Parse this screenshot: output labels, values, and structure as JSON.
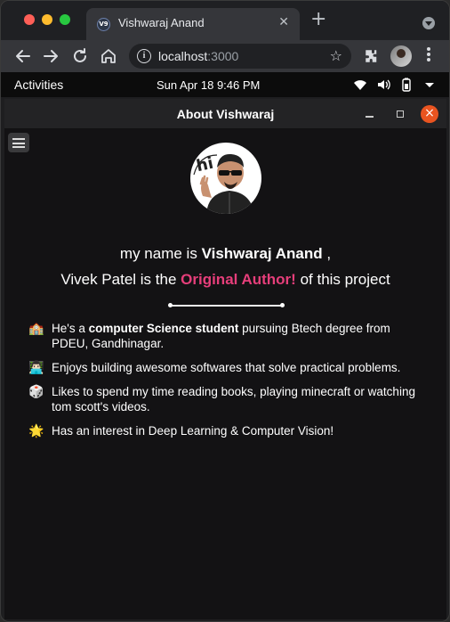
{
  "browser": {
    "tab_title": "Vishwaraj Anand",
    "tab_favicon_text": "V9",
    "url_host": "localhost",
    "url_port": ":3000"
  },
  "system_bar": {
    "activities": "Activities",
    "clock": "Sun Apr 18  9:46 PM"
  },
  "app": {
    "title": "About Vishwaraj",
    "avatar_text": "hi",
    "intro_line1_prefix": "my name is ",
    "intro_line1_name": "Vishwaraj Anand",
    "intro_line1_suffix": " ,",
    "intro_line2_prefix": "Vivek Patel is the ",
    "intro_line2_highlight": "Original Author!",
    "intro_line2_suffix": " of this project",
    "highlight_color": "#e63e7a",
    "facts": [
      {
        "emoji": "🏫",
        "pre": "He's a ",
        "bold": "computer Science student",
        "post": " pursuing Btech degree from PDEU, Gandhinagar."
      },
      {
        "emoji": "👨🏻‍💻",
        "pre": "Enjoys building awesome softwares that solve practical problems.",
        "bold": "",
        "post": ""
      },
      {
        "emoji": "🎲",
        "pre": "Likes to spend my time reading books, playing minecraft or watching tom scott's videos.",
        "bold": "",
        "post": ""
      },
      {
        "emoji": "🌟",
        "pre": "Has an interest in Deep Learning & Computer Vision!",
        "bold": "",
        "post": ""
      }
    ]
  }
}
